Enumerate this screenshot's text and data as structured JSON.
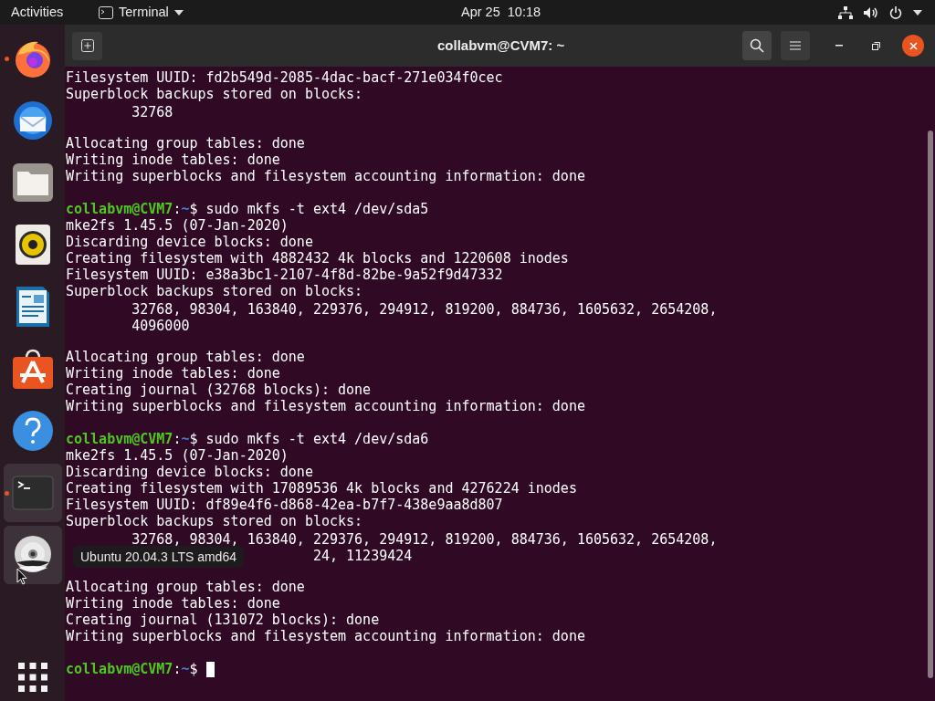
{
  "top_bar": {
    "activities": "Activities",
    "app_menu": "Terminal",
    "clock": "Apr 25  10:18"
  },
  "dock": {
    "items": [
      {
        "kind": "browser",
        "running": true,
        "highlighted": false
      },
      {
        "kind": "mail",
        "running": false,
        "highlighted": false
      },
      {
        "kind": "files",
        "running": false,
        "highlighted": false
      },
      {
        "kind": "music",
        "running": false,
        "highlighted": false
      },
      {
        "kind": "document",
        "running": false,
        "highlighted": false
      },
      {
        "kind": "store",
        "running": false,
        "highlighted": false
      },
      {
        "kind": "help",
        "running": false,
        "highlighted": false
      },
      {
        "kind": "terminal",
        "running": true,
        "highlighted": true
      },
      {
        "kind": "disc",
        "running": false,
        "highlighted": true
      }
    ],
    "tooltip": "Ubuntu 20.04.3 LTS amd64"
  },
  "window": {
    "title": "collabvm@CVM7: ~"
  },
  "terminal": {
    "lines": [
      {
        "kind": "text",
        "text": "Filesystem UUID: fd2b549d-2085-4dac-bacf-271e034f0cec"
      },
      {
        "kind": "text",
        "text": "Superblock backups stored on blocks:"
      },
      {
        "kind": "indented",
        "text": "32768"
      },
      {
        "kind": "blank"
      },
      {
        "kind": "text",
        "text": "Allocating group tables: done"
      },
      {
        "kind": "text",
        "text": "Writing inode tables: done"
      },
      {
        "kind": "text",
        "text": "Writing superblocks and filesystem accounting information: done"
      },
      {
        "kind": "blank"
      },
      {
        "kind": "prompt",
        "user": "collabvm@CVM7",
        "sep": ":",
        "path": "~",
        "symbol": "$",
        "command": "sudo mkfs -t ext4 /dev/sda5",
        "cursor": false
      },
      {
        "kind": "text",
        "text": "mke2fs 1.45.5 (07-Jan-2020)"
      },
      {
        "kind": "text",
        "text": "Discarding device blocks: done"
      },
      {
        "kind": "text",
        "text": "Creating filesystem with 4882432 4k blocks and 1220608 inodes"
      },
      {
        "kind": "text",
        "text": "Filesystem UUID: e38a3bc1-2107-4f8d-82be-9a52f9d47332"
      },
      {
        "kind": "text",
        "text": "Superblock backups stored on blocks:"
      },
      {
        "kind": "indented",
        "text": "32768, 98304, 163840, 229376, 294912, 819200, 884736, 1605632, 2654208,"
      },
      {
        "kind": "indented",
        "text": "4096000"
      },
      {
        "kind": "blank"
      },
      {
        "kind": "text",
        "text": "Allocating group tables: done"
      },
      {
        "kind": "text",
        "text": "Writing inode tables: done"
      },
      {
        "kind": "text",
        "text": "Creating journal (32768 blocks): done"
      },
      {
        "kind": "text",
        "text": "Writing superblocks and filesystem accounting information: done"
      },
      {
        "kind": "blank"
      },
      {
        "kind": "prompt",
        "user": "collabvm@CVM7",
        "sep": ":",
        "path": "~",
        "symbol": "$",
        "command": "sudo mkfs -t ext4 /dev/sda6",
        "cursor": false
      },
      {
        "kind": "text",
        "text": "mke2fs 1.45.5 (07-Jan-2020)"
      },
      {
        "kind": "text",
        "text": "Discarding device blocks: done"
      },
      {
        "kind": "text",
        "text": "Creating filesystem with 17089536 4k blocks and 4276224 inodes"
      },
      {
        "kind": "text",
        "text": "Filesystem UUID: df89e4f6-d868-42ea-b7f7-438e9aa8d807"
      },
      {
        "kind": "text",
        "text": "Superblock backups stored on blocks:"
      },
      {
        "kind": "indented",
        "text": "32768, 98304, 163840, 229376, 294912, 819200, 884736, 1605632, 2654208,"
      },
      {
        "kind": "covered",
        "text": "24, 11239424"
      },
      {
        "kind": "blank"
      },
      {
        "kind": "text",
        "text": "Allocating group tables: done"
      },
      {
        "kind": "text",
        "text": "Writing inode tables: done"
      },
      {
        "kind": "text",
        "text": "Creating journal (131072 blocks): done"
      },
      {
        "kind": "text",
        "text": "Writing superblocks and filesystem accounting information: done"
      },
      {
        "kind": "blank"
      },
      {
        "kind": "prompt",
        "user": "collabvm@CVM7",
        "sep": ":",
        "path": "~",
        "symbol": "$",
        "cursor": true
      }
    ]
  }
}
